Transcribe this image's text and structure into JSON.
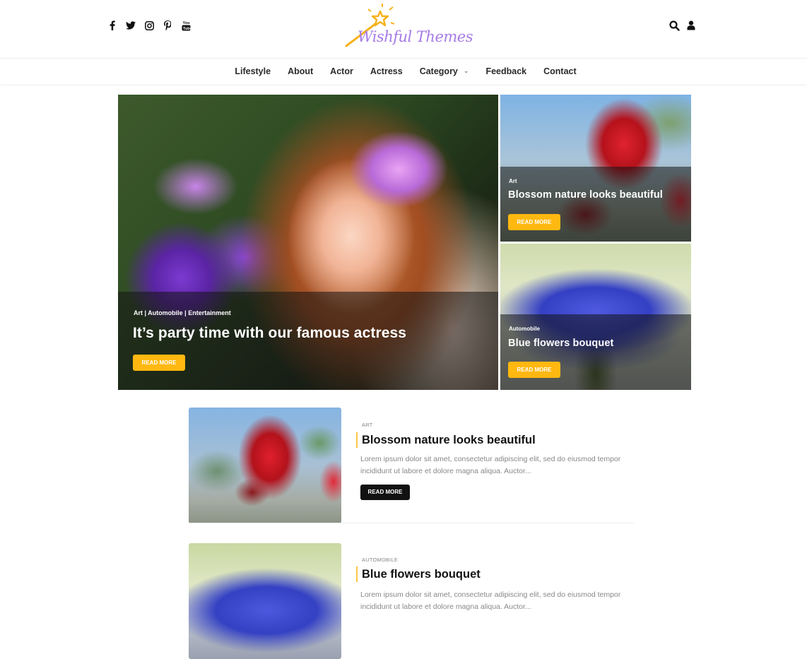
{
  "header": {
    "social": [
      {
        "name": "facebook",
        "icon": "facebook-icon"
      },
      {
        "name": "twitter",
        "icon": "twitter-icon"
      },
      {
        "name": "instagram",
        "icon": "instagram-icon"
      },
      {
        "name": "pinterest",
        "icon": "pinterest-icon"
      },
      {
        "name": "youtube",
        "icon": "youtube-icon"
      }
    ],
    "logo_text": "Wishful Themes",
    "actions": [
      {
        "name": "search",
        "icon": "search-icon"
      },
      {
        "name": "account",
        "icon": "user-icon"
      }
    ]
  },
  "nav": {
    "items": [
      {
        "label": "Lifestyle"
      },
      {
        "label": "About"
      },
      {
        "label": "Actor"
      },
      {
        "label": "Actress"
      },
      {
        "label": "Category",
        "has_dropdown": true,
        "dropdown_icon": "⌄"
      },
      {
        "label": "Feedback"
      },
      {
        "label": "Contact"
      }
    ]
  },
  "featured": {
    "main": {
      "categories": "Art | Automobile | Entertainment",
      "title": "It’s party time with our famous actress",
      "button": "READ MORE"
    },
    "side": [
      {
        "category": "Art",
        "title": "Blossom nature looks beautiful",
        "button": "READ MORE"
      },
      {
        "category": "Automobile",
        "title": "Blue flowers bouquet",
        "button": "READ MORE"
      }
    ]
  },
  "posts": [
    {
      "category": "ART",
      "title": "Blossom nature looks beautiful",
      "excerpt": "Lorem ipsum dolor sit amet, consectetur adipiscing elit, sed do eiusmod tempor incididunt ut labore et dolore magna aliqua. Auctor...",
      "button": "READ MORE"
    },
    {
      "category": "AUTOMOBILE",
      "title": "Blue flowers bouquet",
      "excerpt": "Lorem ipsum dolor sit amet, consectetur adipiscing elit, sed do eiusmod tempor incididunt ut labore et dolore magna aliqua. Auctor..."
    }
  ],
  "colors": {
    "accent_yellow": "#ffb810",
    "logo_purple": "#a67be6",
    "logo_star": "#f6b21a",
    "dark_button": "#111111"
  }
}
